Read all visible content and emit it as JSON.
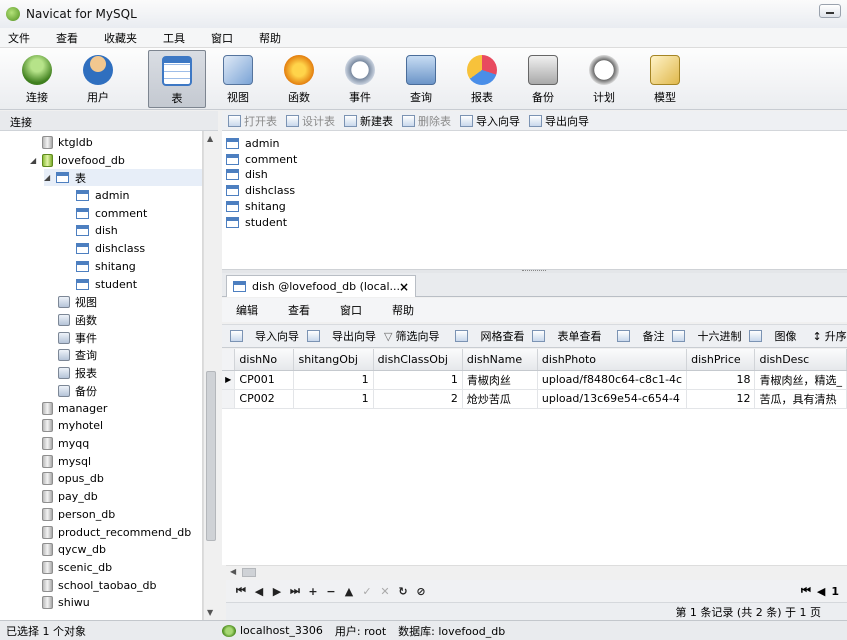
{
  "window": {
    "title": "Navicat for MySQL"
  },
  "menu": [
    "文件",
    "查看",
    "收藏夹",
    "工具",
    "窗口",
    "帮助"
  ],
  "toolbar": [
    {
      "label": "连接",
      "icon": "connection-icon"
    },
    {
      "label": "用户",
      "icon": "user-icon"
    },
    {
      "label": "表",
      "icon": "table-icon",
      "active": true
    },
    {
      "label": "视图",
      "icon": "view-icon"
    },
    {
      "label": "函数",
      "icon": "function-icon"
    },
    {
      "label": "事件",
      "icon": "event-icon"
    },
    {
      "label": "查询",
      "icon": "query-icon"
    },
    {
      "label": "报表",
      "icon": "report-icon"
    },
    {
      "label": "备份",
      "icon": "backup-icon"
    },
    {
      "label": "计划",
      "icon": "schedule-icon"
    },
    {
      "label": "模型",
      "icon": "model-icon"
    }
  ],
  "left_panel": {
    "header": "连接"
  },
  "tree": {
    "top_db": "ktgldb",
    "open_db": "lovefood_db",
    "tables_node": "表",
    "tables": [
      "admin",
      "comment",
      "dish",
      "dishclass",
      "shitang",
      "student"
    ],
    "other_nodes": [
      "视图",
      "函数",
      "事件",
      "查询",
      "报表",
      "备份"
    ],
    "databases": [
      "manager",
      "myhotel",
      "myqq",
      "mysql",
      "opus_db",
      "pay_db",
      "person_db",
      "product_recommend_db",
      "qycw_db",
      "scenic_db",
      "school_taobao_db",
      "shiwu"
    ]
  },
  "object_toolbar": [
    {
      "label": "打开表",
      "disabled": true
    },
    {
      "label": "设计表",
      "disabled": true
    },
    {
      "label": "新建表",
      "disabled": false
    },
    {
      "label": "删除表",
      "disabled": true
    },
    {
      "label": "导入向导",
      "disabled": false
    },
    {
      "label": "导出向导",
      "disabled": false
    }
  ],
  "object_list": [
    "admin",
    "comment",
    "dish",
    "dishclass",
    "shitang",
    "student"
  ],
  "tab": {
    "title": "dish @lovefood_db (local...",
    "close": "×"
  },
  "sub_menu": [
    "编辑",
    "查看",
    "窗口",
    "帮助"
  ],
  "grid_toolbar": [
    "导入向导",
    "导出向导",
    "筛选向导",
    "网格查看",
    "表单查看",
    "备注",
    "十六进制",
    "图像",
    "升序排序"
  ],
  "grid": {
    "columns": [
      "dishNo",
      "shitangObj",
      "dishClassObj",
      "dishName",
      "dishPhoto",
      "dishPrice",
      "dishDesc"
    ],
    "rows": [
      [
        "CP001",
        "1",
        "1",
        "青椒肉丝",
        "upload/f8480c64-c8c1-4c",
        "18",
        "青椒肉丝，精选_"
      ],
      [
        "CP002",
        "1",
        "2",
        "炝炒苦瓜",
        "upload/13c69e54-c654-4",
        "12",
        "苦瓜，具有清热"
      ]
    ]
  },
  "nav": {
    "right_label": "1"
  },
  "record_status": "第 1 条记录 (共 2 条) 于 1 页",
  "status": {
    "left": "已选择 1 个对象",
    "connection": "localhost_3306",
    "user": "用户: root",
    "database": "数据库: lovefood_db"
  }
}
